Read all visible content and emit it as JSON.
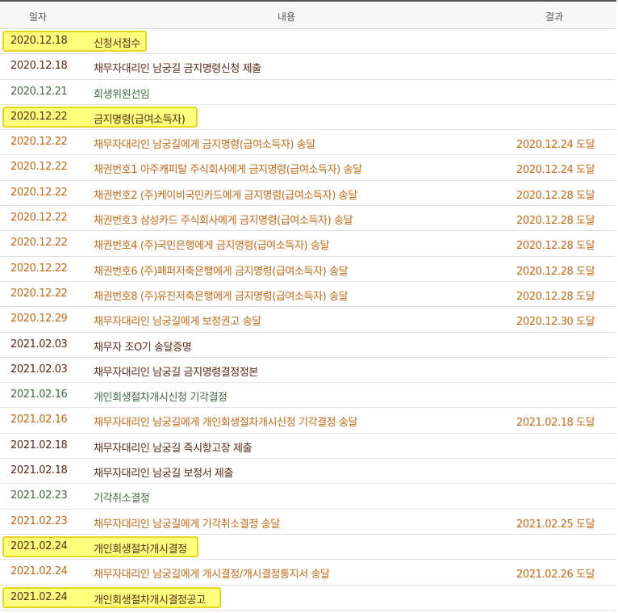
{
  "header": {
    "date": "일자",
    "content": "내용",
    "result": "결과"
  },
  "rows": [
    {
      "date": "2020.12.18",
      "content": "신청서접수",
      "result": "",
      "tone": "dark",
      "highlight": true,
      "hlw": 179
    },
    {
      "date": "2020.12.18",
      "content": "채무자대리인 남궁길 금지명령신청 제출",
      "result": "",
      "tone": "dark"
    },
    {
      "date": "2020.12.21",
      "content": "회생위원선임",
      "result": "",
      "tone": "green"
    },
    {
      "date": "2020.12.22",
      "content": "금지명령(급여소득자)",
      "result": "",
      "tone": "dark",
      "highlight": true,
      "hlw": 242
    },
    {
      "date": "2020.12.22",
      "content": "채무자대리인 남궁길에게 금지명령(급여소득자) 송달",
      "result": "2020.12.24 도달",
      "tone": "orange"
    },
    {
      "date": "2020.12.22",
      "content": "채권번호1 아주캐피탈 주식회사에게 금지명령(급여소득자) 송달",
      "result": "2020.12.24 도달",
      "tone": "orange"
    },
    {
      "date": "2020.12.22",
      "content": "채권번호2 (주)케이비국민카드에게 금지명령(급여소득자) 송달",
      "result": "2020.12.28 도달",
      "tone": "orange"
    },
    {
      "date": "2020.12.22",
      "content": "채권번호3 삼성카드 주식회사에게 금지명령(급여소득자) 송달",
      "result": "2020.12.28 도달",
      "tone": "orange"
    },
    {
      "date": "2020.12.22",
      "content": "채권번호4 (주)국민은행에게 금지명령(급여소득자) 송달",
      "result": "2020.12.28 도달",
      "tone": "orange"
    },
    {
      "date": "2020.12.22",
      "content": "채권번호6 (주)페퍼저축은행에게 금지명령(급여소득자) 송달",
      "result": "2020.12.28 도달",
      "tone": "orange"
    },
    {
      "date": "2020.12.22",
      "content": "채권번호8 (주)유진저축은행에게 금지명령(급여소득자) 송달",
      "result": "2020.12.28 도달",
      "tone": "orange"
    },
    {
      "date": "2020.12.29",
      "content": "채무자대리인 남궁길에게 보정권고 송달",
      "result": "2020.12.30 도달",
      "tone": "orange"
    },
    {
      "date": "2021.02.03",
      "content": "채무자 조O기 송달증명",
      "result": "",
      "tone": "dark"
    },
    {
      "date": "2021.02.03",
      "content": "채무자대리인 남궁길 금지명령결정정본",
      "result": "",
      "tone": "dark"
    },
    {
      "date": "2021.02.16",
      "content": "개인회생절차개시신청 기각결정",
      "result": "",
      "tone": "green"
    },
    {
      "date": "2021.02.16",
      "content": "채무자대리인 남궁길에게 개인회생절차개시신청 기각결정 송달",
      "result": "2021.02.18 도달",
      "tone": "orange"
    },
    {
      "date": "2021.02.18",
      "content": "채무자대리인 남궁길 즉시항고장 제출",
      "result": "",
      "tone": "dark"
    },
    {
      "date": "2021.02.18",
      "content": "채무자대리인 남궁길 보정서 제출",
      "result": "",
      "tone": "dark"
    },
    {
      "date": "2021.02.23",
      "content": "기각취소결정",
      "result": "",
      "tone": "green"
    },
    {
      "date": "2021.02.23",
      "content": "채무자대리인 남궁길에게 기각취소결정 송달",
      "result": "2021.02.25 도달",
      "tone": "orange"
    },
    {
      "date": "2021.02.24",
      "content": "개인회생절차개시결정",
      "result": "",
      "tone": "dark",
      "highlight": true,
      "hlw": 243
    },
    {
      "date": "2021.02.24",
      "content": "채무자대리인 남궁길에게 개시결정/개시결정통지서 송달",
      "result": "2021.02.26 도달",
      "tone": "orange"
    },
    {
      "date": "2021.02.24",
      "content": "개인회생절차개시결정공고",
      "result": "",
      "tone": "dark",
      "highlight": true,
      "hlw": 271
    }
  ]
}
